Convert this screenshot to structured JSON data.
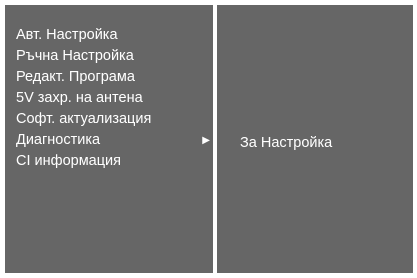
{
  "menu": {
    "items": [
      {
        "label": "Авт. Настройка"
      },
      {
        "label": "Ръчна Настройка"
      },
      {
        "label": "Редакт. Програма"
      },
      {
        "label": "5V захр. на антена"
      },
      {
        "label": "Софт. актуализация"
      },
      {
        "label": "Диагностика",
        "selected": true,
        "arrow": "▶"
      },
      {
        "label": "CI информация"
      }
    ]
  },
  "submenu": {
    "items": [
      {
        "label": "За Настройка"
      }
    ]
  },
  "colors": {
    "panel_background": "#666666",
    "divider": "#ffffff",
    "text": "#ffffff"
  },
  "icons": {
    "submenu_arrow": "right-triangle-icon"
  }
}
